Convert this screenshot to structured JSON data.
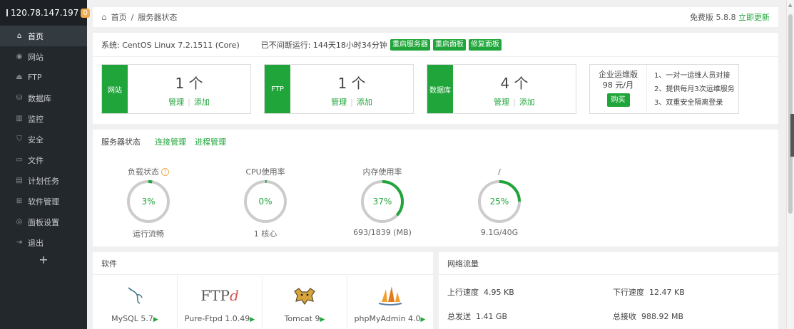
{
  "sidebar": {
    "ip": "120.78.147.197",
    "badge": "0",
    "items": [
      {
        "icon": "⌂",
        "label": "首页",
        "active": true
      },
      {
        "icon": "◉",
        "label": "网站"
      },
      {
        "icon": "⏏",
        "label": "FTP"
      },
      {
        "icon": "⛁",
        "label": "数据库"
      },
      {
        "icon": "▥",
        "label": "监控"
      },
      {
        "icon": "⛉",
        "label": "安全"
      },
      {
        "icon": "▭",
        "label": "文件"
      },
      {
        "icon": "▤",
        "label": "计划任务"
      },
      {
        "icon": "⊞",
        "label": "软件管理"
      },
      {
        "icon": "◎",
        "label": "面板设置"
      },
      {
        "icon": "⇥",
        "label": "退出"
      }
    ],
    "add": "+"
  },
  "breadcrumb": {
    "home": "首页",
    "sep": "/",
    "current": "服务器状态"
  },
  "version": {
    "text": "免费版 5.8.8",
    "update": "立即更新"
  },
  "system": {
    "os": "系统: CentOS Linux 7.2.1511 (Core)",
    "uptime": "已不间断运行: 144天18小时34分钟",
    "buttons": [
      "重启服务器",
      "重启面板",
      "修复面板"
    ]
  },
  "cards": [
    {
      "label": "网站",
      "count": "1 个",
      "manage": "管理",
      "add": "添加"
    },
    {
      "label": "FTP",
      "count": "1 个",
      "manage": "管理",
      "add": "添加"
    },
    {
      "label": "数据库",
      "count": "4 个",
      "manage": "管理",
      "add": "添加"
    }
  ],
  "enterprise": {
    "title": "企业运维版",
    "price": "98 元/月",
    "buy": "购买",
    "features": [
      "1、一对一运维人员对接",
      "2、提供每月3次运维服务",
      "3、双重安全隔离登录"
    ]
  },
  "status": {
    "title": "服务器状态",
    "tabs": [
      "连接管理",
      "进程管理"
    ],
    "gauges": [
      {
        "title": "负载状态",
        "help": "?",
        "value": "3%",
        "percent": 3,
        "bottom": "运行流畅"
      },
      {
        "title": "CPU使用率",
        "value": "0%",
        "percent": 0,
        "bottom": "1 核心"
      },
      {
        "title": "内存使用率",
        "value": "37%",
        "percent": 37,
        "bottom": "693/1839 (MB)"
      },
      {
        "title": "/",
        "value": "25%",
        "percent": 25,
        "bottom": "9.1G/40G"
      }
    ]
  },
  "software": {
    "title": "软件",
    "items": [
      {
        "name": "MySQL 5.7",
        "icon": "dolphin-icon"
      },
      {
        "name": "Pure-Ftpd 1.0.49",
        "icon": "ftpd-logo-icon",
        "logo_text": "FTP",
        "logo_mark": "d"
      },
      {
        "name": "Tomcat 9",
        "icon": "tomcat-icon"
      },
      {
        "name": "phpMyAdmin 4.0",
        "icon": "sailboat-icon"
      }
    ],
    "play": "▶"
  },
  "network": {
    "title": "网络流量",
    "up_label": "上行速度",
    "up_value": "4.95 KB",
    "down_label": "下行速度",
    "down_value": "12.47 KB",
    "sent_label": "总发送",
    "sent_value": "1.41 GB",
    "recv_label": "总接收",
    "recv_value": "988.92 MB"
  },
  "colors": {
    "accent": "#20a53a",
    "sidebar": "#23282d",
    "gauge_track": "#cccccc",
    "gauge_fill": "#20a53a"
  }
}
